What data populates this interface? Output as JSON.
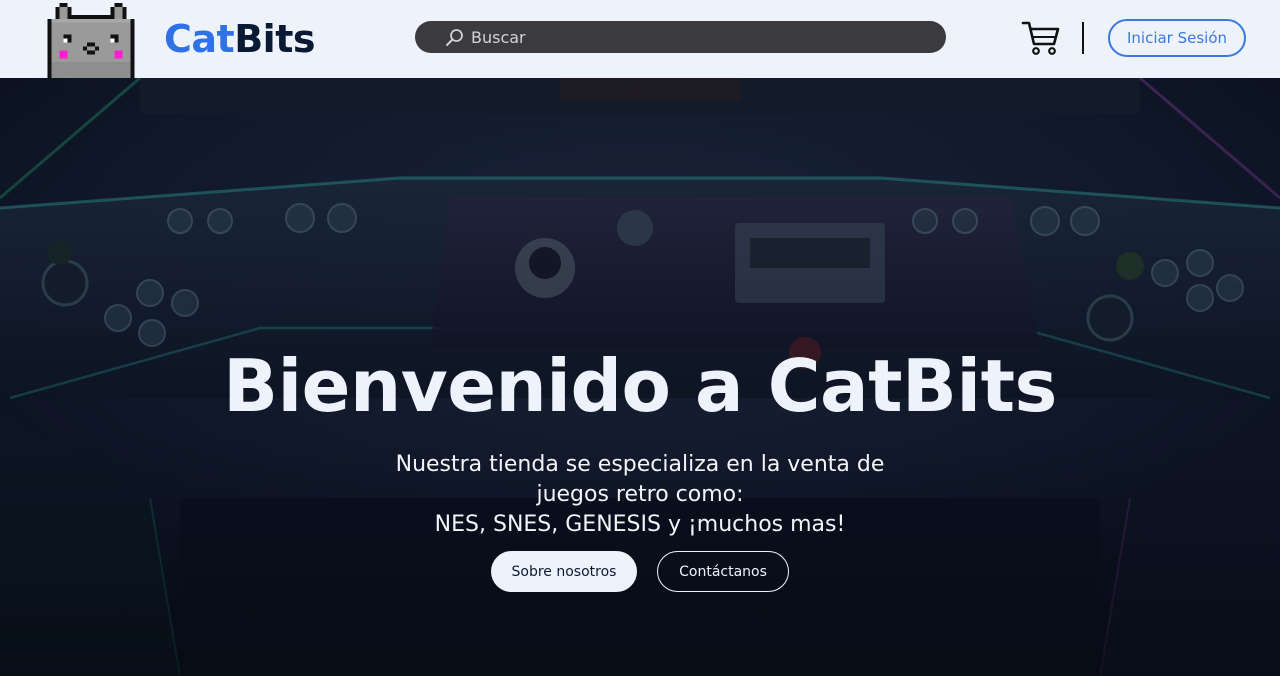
{
  "brand": {
    "name_part1": "Cat",
    "name_part2": "Bits",
    "logo_icon": "pixel-cat-icon",
    "colors": {
      "primary": "#2f72e8",
      "dark": "#0b1a33",
      "header_bg": "#eef3fb"
    }
  },
  "search": {
    "placeholder": "Buscar",
    "icon": "search-icon"
  },
  "header": {
    "cart_icon": "cart-icon",
    "login_label": "Iniciar Sesión"
  },
  "hero": {
    "background": "arcade-cabinet-controls-image",
    "title": "Bienvenido a CatBits",
    "subtitle_lines": [
      "Nuestra tienda se especializa en la venta de",
      "juegos retro como:",
      "NES, SNES, GENESIS y ¡muchos mas!"
    ],
    "buttons": {
      "about_label": "Sobre nosotros",
      "contact_label": "Contáctanos"
    }
  }
}
